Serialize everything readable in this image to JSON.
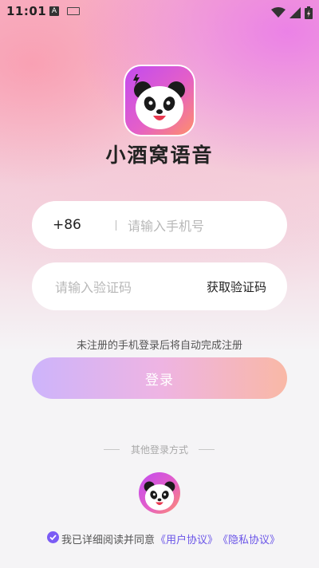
{
  "status_bar": {
    "time": "11:01",
    "keyboard_label": "A"
  },
  "app": {
    "name": "小酒窝语音"
  },
  "phone": {
    "prefix": "+86",
    "placeholder": "请输入手机号"
  },
  "code": {
    "placeholder": "请输入验证码",
    "get_code_label": "获取验证码"
  },
  "hint": "未注册的手机登录后将自动完成注册",
  "login_button": "登录",
  "other_login_label": "其他登录方式",
  "agreement": {
    "text": "我已详细阅读并同意",
    "user_agreement": "《用户协议》",
    "privacy_agreement": "《隐私协议》"
  },
  "colors": {
    "accent": "#7b5cf5",
    "link": "#6a55e8"
  },
  "icons": {
    "logo": "panda-logo-icon",
    "alt_login": "panda-login-icon"
  }
}
